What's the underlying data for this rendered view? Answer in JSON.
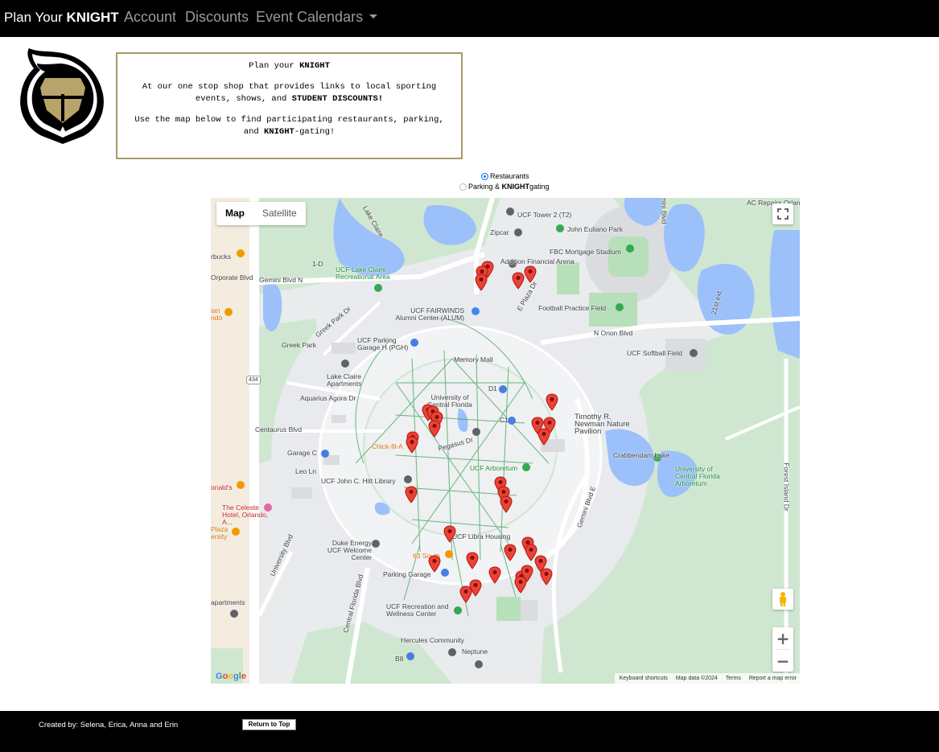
{
  "navbar": {
    "brand_prefix": "Plan Your ",
    "brand_bold": "KNIGHT",
    "links": [
      {
        "label": "Account"
      },
      {
        "label": "Discounts"
      },
      {
        "label": "Event Calendars"
      }
    ]
  },
  "intro": {
    "line1_prefix": "Plan your ",
    "line1_bold": "KNIGHT",
    "line2_prefix": "At our one stop shop that provides links to local sporting events, shows, and ",
    "line2_bold": "STUDENT DISCOUNTS!",
    "line3_prefix": "Use the map below to find participating restaurants, parking, and ",
    "line3_bold": "KNIGHT",
    "line3_suffix": "-gating!"
  },
  "filter": {
    "restaurants_label": "Restaurants",
    "restaurants_selected": true,
    "parking_prefix": "Parking & ",
    "parking_bold": "KNIGHT",
    "parking_suffix": "gating",
    "parking_selected": false
  },
  "map": {
    "type_map": "Map",
    "type_satellite": "Satellite",
    "zoom_in": "+",
    "zoom_out": "−",
    "google": "Google",
    "attribution": [
      "Keyboard shortcuts",
      "Map data ©2024",
      "Terms",
      "Report a map error"
    ],
    "labels": [
      "UCF Tower 2 (T2)",
      "Zipcar",
      "John Euliano Park",
      "FBC Mortgage Stadium",
      "Addition Financial Arena",
      "UCF Lake Claire Recreational Area",
      "Lake Claire",
      "Gemini Blvd N",
      "1-D",
      "UCF FAIRWINDS Alumni Center (ALUM)",
      "Football Practice Field",
      "E Plaza Dr",
      "N Orion Blvd",
      "UCF Softball Field",
      "21st ext.",
      "Greek Park",
      "Greek Park Dr",
      "UCF Parking Garage H (PGH)",
      "Lake Claire Apartments",
      "Memory Mall",
      "Aquarius Agora Dr",
      "University of Central Florida",
      "D1",
      "C1",
      "Timothy R. Newman Nature Pavilion",
      "Centaurus Blvd",
      "Chick-fil-A",
      "Pegasus Dr",
      "Crabbendam Lake",
      "UCF Arboretum",
      "University of Central Florida Arboretum",
      "Garage C",
      "Leo Ln",
      "UCF John C. Hitt Library",
      "Gemini Blvd E",
      "The Celeste Hotel, Orlando, A...",
      "onald's",
      "UCF Libra Housing",
      "Duke Energy UCF Welcome Center",
      "63 South",
      "Parking Garage",
      "UCF Recreation and Wellness Center",
      "Hercules Community",
      "Neptune",
      "B8",
      "University Blvd",
      "Central Florida Blvd",
      "Forest Island Dr",
      "AC Repairs Orlando",
      "Gemini Blvd",
      "Orporate Blvd",
      "rbucks",
      "ian ndo",
      "Plaza ersity",
      "apartments",
      "434"
    ]
  },
  "footer": {
    "credit": "Created by: Selena, Erica, Anna and Erin",
    "top_button": "Return to Top"
  },
  "colors": {
    "nav_bg": "#000000",
    "ucf_gold": "#a89968",
    "marker_red": "#ea4335",
    "park_green": "#bfe3c4",
    "water_blue": "#9cc0f9"
  }
}
